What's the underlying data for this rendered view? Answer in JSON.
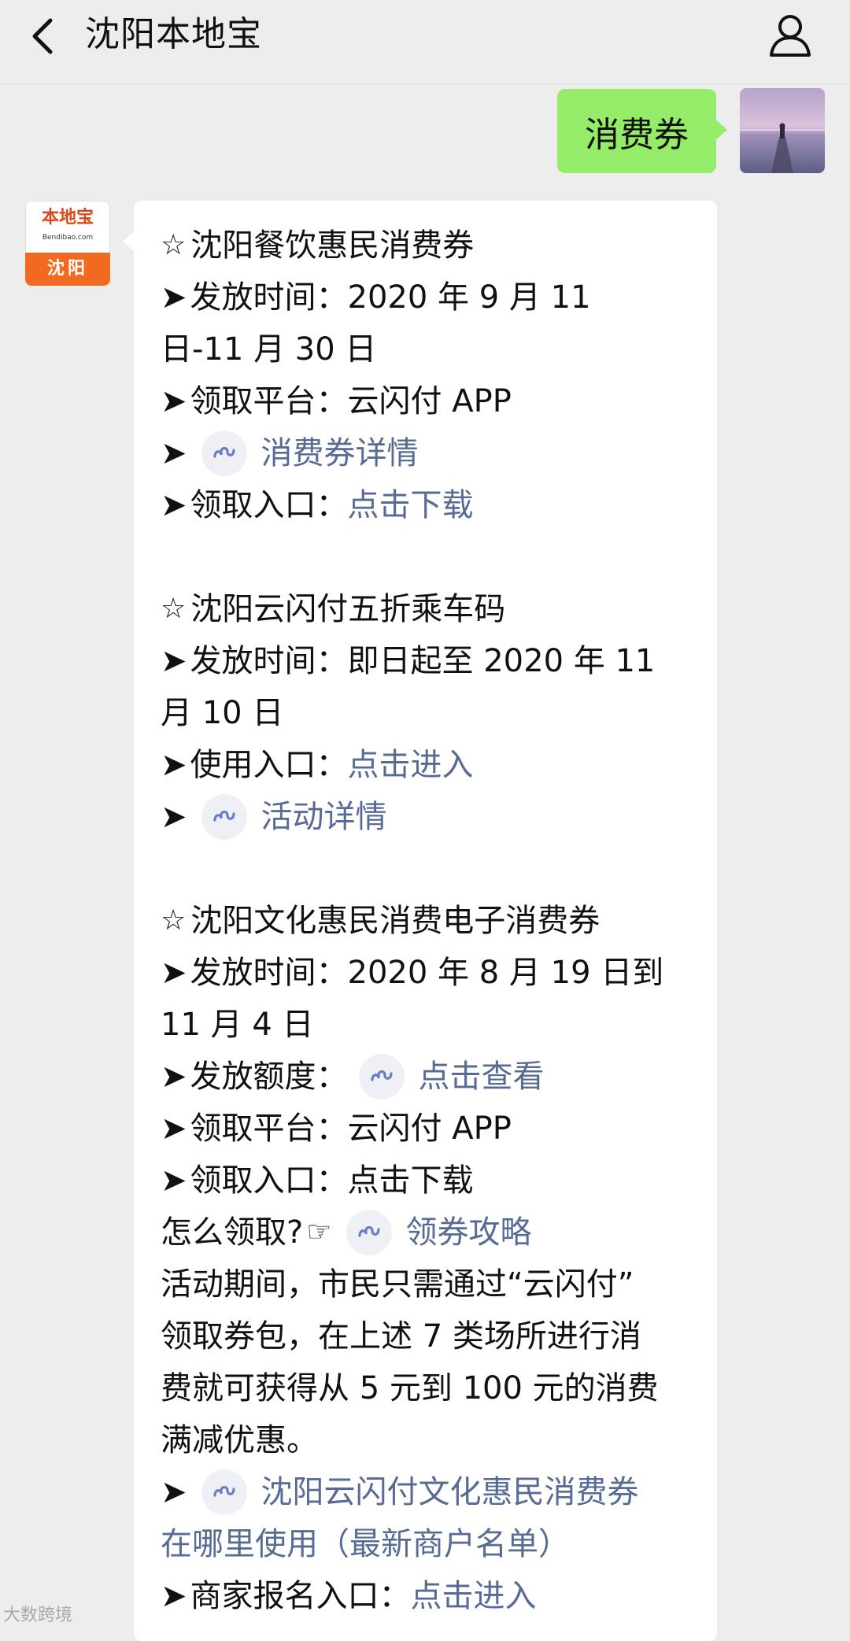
{
  "header": {
    "title": "沈阳本地宝"
  },
  "outgoing": {
    "text": "消费券"
  },
  "brand": {
    "logo_text": "本地宝",
    "logo_domain": "Bendibao.com",
    "city": "沈阳"
  },
  "message": {
    "l01_title": "沈阳餐饮惠民消费券",
    "l02": "发放时间：2020 年 9 月 11",
    "l03": "日-11 月 30 日",
    "l04": "领取平台：云闪付 APP",
    "l05_link": "消费券详情",
    "l06_label": "领取入口：",
    "l06_link": "点击下载",
    "l08_title": "沈阳云闪付五折乘车码",
    "l09": "发放时间：即日起至 2020 年 11",
    "l10": "月 10 日",
    "l11_label": "使用入口：",
    "l11_link": "点击进入",
    "l12_link": "活动详情",
    "l14_title": "沈阳文化惠民消费电子消费券",
    "l15": "发放时间：2020 年 8 月 19 日到",
    "l16": "11 月 4 日",
    "l17_label": "发放额度：",
    "l17_link": "点击查看",
    "l18": "领取平台：云闪付 APP",
    "l19": "领取入口：点击下载",
    "l20_label": "怎么领取?",
    "l20_link": "领券攻略",
    "l21": "活动期间，市民只需通过“云闪付”",
    "l22": "领取券包，在上述 7 类场所进行消",
    "l23": "费就可获得从 5 元到 100 元的消费",
    "l24": "满减优惠。",
    "l25_link": "沈阳云闪付文化惠民消费券",
    "l26_link": "在哪里使用（最新商户名单）",
    "l27_label": "商家报名入口：",
    "l27_link": "点击进入"
  },
  "watermark": "大数跨境",
  "colors": {
    "background": "#ededed",
    "outgoing_bubble": "#95ec69",
    "incoming_bubble": "#ffffff",
    "link": "#576b95",
    "brand_orange": "#f26a20"
  },
  "icons": {
    "back": "chevron-left-icon",
    "profile": "person-icon",
    "mini_program": "mini-program-link-icon",
    "star": "star-outline-icon",
    "arrow": "arrow-bullet-icon",
    "hand": "pointing-hand-icon"
  }
}
